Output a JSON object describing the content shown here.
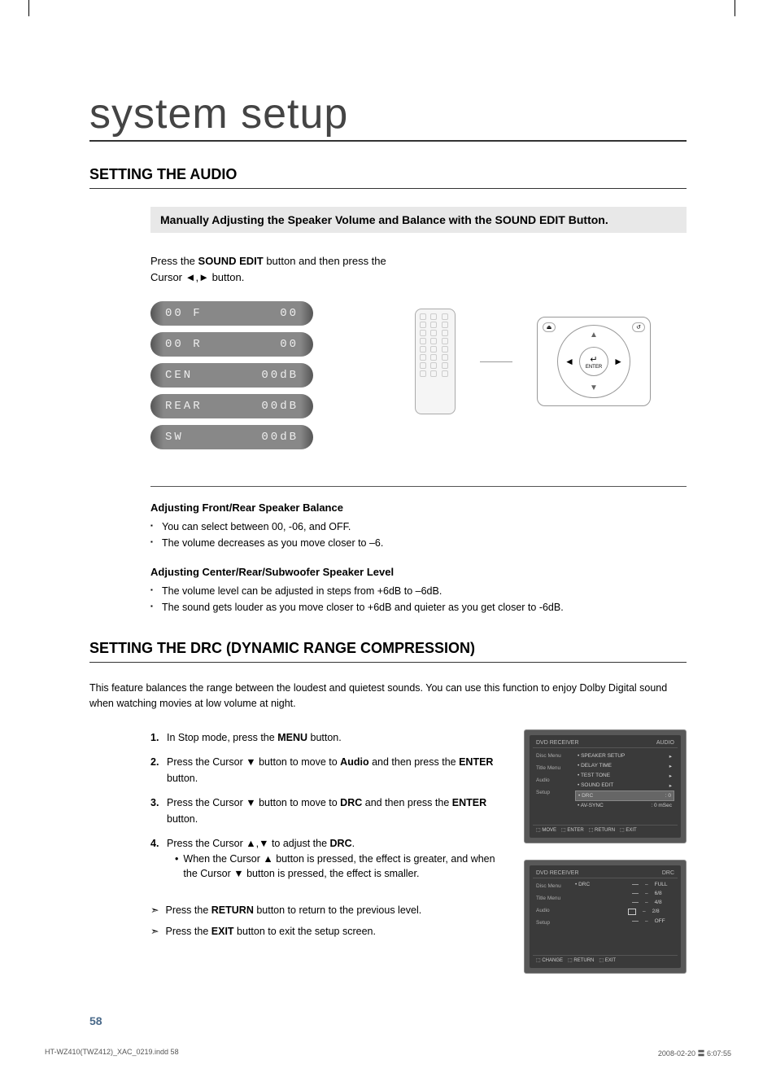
{
  "title": "system setup",
  "section1": {
    "heading": "SETTING THE AUDIO",
    "subheading": "Manually Adjusting the Speaker Volume and Balance with the SOUND EDIT Button.",
    "instruction_pre": "Press the ",
    "instruction_bold": "SOUND EDIT",
    "instruction_post": " button and then press the Cursor ◄,► button.",
    "lcd": [
      {
        "left": "00 F",
        "right": "00"
      },
      {
        "left": "00 R",
        "right": "00"
      },
      {
        "left": "CEN",
        "right": "00dB"
      },
      {
        "left": "REAR",
        "right": "00dB"
      },
      {
        "left": "SW",
        "right": "00dB"
      }
    ],
    "dpad_enter": "ENTER",
    "adjust1_heading": "Adjusting Front/Rear Speaker Balance",
    "adjust1_items": [
      "You can select between 00, -06, and OFF.",
      "The volume decreases as you move closer to –6."
    ],
    "adjust2_heading": "Adjusting Center/Rear/Subwoofer Speaker Level",
    "adjust2_items": [
      "The volume level can be adjusted in steps from +6dB to –6dB.",
      "The sound gets louder as you move closer to +6dB and quieter as you get closer to -6dB."
    ]
  },
  "section2": {
    "heading": "SETTING THE DRC (DYNAMIC RANGE COMPRESSION)",
    "intro": "This feature balances the range between the loudest and quietest sounds. You can use this function to enjoy Dolby Digital sound when watching movies at low volume at night.",
    "steps": [
      {
        "n": "1.",
        "pre": "In Stop mode, press the ",
        "b": "MENU",
        "post": " button."
      },
      {
        "n": "2.",
        "pre": "Press the Cursor ▼ button to move to ",
        "b": "Audio",
        "post": " and then press the ",
        "b2": "ENTER",
        "post2": " button."
      },
      {
        "n": "3.",
        "pre": "Press the Cursor ▼ button to move to ",
        "b": "DRC",
        "post": " and then press the ",
        "b2": "ENTER",
        "post2": " button."
      },
      {
        "n": "4.",
        "pre": "Press the Cursor ▲,▼ to adjust the ",
        "b": "DRC",
        "post": ".",
        "sub": "When the Cursor ▲ button is pressed, the effect is greater, and when the Cursor ▼ button is pressed, the effect is smaller."
      }
    ],
    "notes": [
      {
        "pre": "Press the ",
        "b": "RETURN",
        "post": " button to return to the previous level."
      },
      {
        "pre": "Press the ",
        "b": "EXIT",
        "post": " button to exit the setup screen."
      }
    ],
    "osd1": {
      "title_left": "DVD RECEIVER",
      "title_right": "AUDIO",
      "side": [
        "Disc Menu",
        "Title Menu",
        "Audio",
        "Setup"
      ],
      "items": [
        {
          "l": "• SPEAKER SETUP",
          "r": "▸"
        },
        {
          "l": "• DELAY TIME",
          "r": "▸"
        },
        {
          "l": "• TEST TONE",
          "r": "▸"
        },
        {
          "l": "• SOUND EDIT",
          "r": "▸"
        },
        {
          "l": "• DRC",
          "r": ": 0",
          "sel": true
        },
        {
          "l": "• AV-SYNC",
          "r": ": 0 mSec"
        }
      ],
      "footer": [
        "MOVE",
        "ENTER",
        "RETURN",
        "EXIT"
      ]
    },
    "osd2": {
      "title_left": "DVD RECEIVER",
      "title_right": "DRC",
      "side": [
        "Disc Menu",
        "Title Menu",
        "Audio",
        "Setup"
      ],
      "drc_label": "• DRC",
      "scale": [
        "FULL",
        "6/8",
        "4/8",
        "2/8",
        "OFF"
      ],
      "footer": [
        "CHANGE",
        "RETURN",
        "EXIT"
      ]
    }
  },
  "page_number": "58",
  "footer_left": "HT-WZ410(TWZ412)_XAC_0219.indd   58",
  "footer_right": "2008-02-20   〓 6:07:55"
}
